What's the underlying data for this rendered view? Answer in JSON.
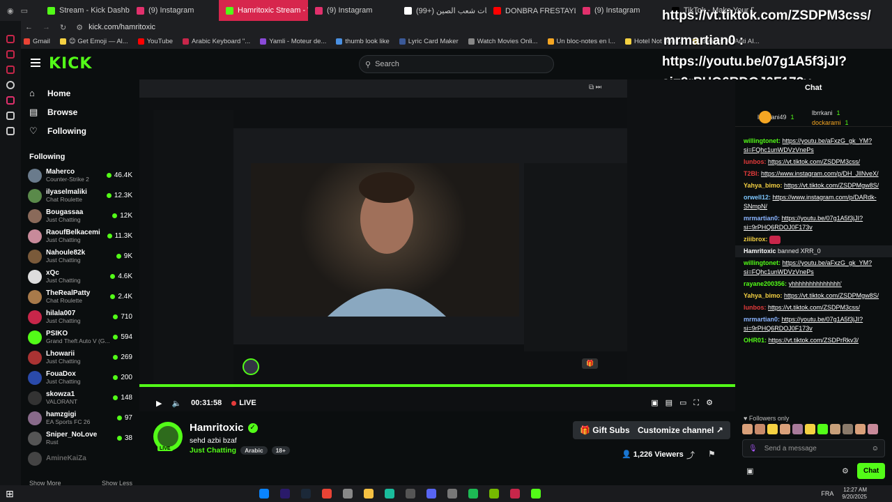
{
  "browser": {
    "tabs": [
      {
        "label": "Stream - Kick Dashboard",
        "color": "#53fc18",
        "active": false
      },
      {
        "label": "(9) Instagram",
        "color": "#e1306c",
        "active": false
      },
      {
        "label": "Hamritoxic Stream - Wat",
        "color": "#53fc18",
        "active": true
      },
      {
        "label": "(9) Instagram",
        "color": "#e1306c",
        "active": false
      },
      {
        "label": "(99+) ضحكات شعب الصين",
        "color": "#ffffff",
        "active": false
      },
      {
        "label": "DONBRA FRESTAYL 🔥 RI",
        "color": "#ff0000",
        "active": false
      },
      {
        "label": "(9) Instagram",
        "color": "#e1306c",
        "active": false
      },
      {
        "label": "TikTok - Make Your Day",
        "color": "#000000",
        "active": false
      }
    ],
    "url": "kick.com/hamritoxic",
    "bookmarks": [
      "Gmail",
      "😊 Get Emoji — Al...",
      "YouTube",
      "Arabic Keyboard \"...",
      "Yamli - Moteur de...",
      "thumb look like",
      "Lyric Card Maker",
      "Watch Movies Onli...",
      "Un bloc-notes en l...",
      "Hotel Not Hote...",
      "Bypass AI: Anti AI..."
    ]
  },
  "overlay": {
    "line1": "https://vt.tiktok.com/ZSDPM3css/",
    "line2": "mrmartian0 :",
    "line3": "https://youtu.be/07g1A5f3jJI?",
    "line4": "si=9rPHQ6RDOJ0F173v"
  },
  "kick": {
    "logo": "KICK",
    "search_placeholder": "Search",
    "nav": [
      {
        "label": "Home",
        "icon": "home-icon"
      },
      {
        "label": "Browse",
        "icon": "browse-icon"
      },
      {
        "label": "Following",
        "icon": "heart-icon"
      }
    ],
    "following_title": "Following",
    "channels": [
      {
        "name": "Maherco",
        "game": "Counter-Strike 2",
        "viewers": "46.4K",
        "color": "#6a7b8c"
      },
      {
        "name": "ilyaselmaliki",
        "game": "Chat Roulette",
        "viewers": "12.3K",
        "color": "#5a8a4a"
      },
      {
        "name": "Bougassaa",
        "game": "Just Chatting",
        "viewers": "12K",
        "color": "#8a6a5a"
      },
      {
        "name": "RaoufBelkacemi",
        "game": "Just Chatting",
        "viewers": "11.3K",
        "color": "#c88a9a"
      },
      {
        "name": "Nahoule82k",
        "game": "Just Chatting",
        "viewers": "9K",
        "color": "#7a5a3a"
      },
      {
        "name": "xQc",
        "game": "Just Chatting",
        "viewers": "4.6K",
        "color": "#dddddd"
      },
      {
        "name": "TheRealPatty",
        "game": "Chat Roulette",
        "viewers": "2.4K",
        "color": "#a87a4a"
      },
      {
        "name": "hilala007",
        "game": "Just Chatting",
        "viewers": "710",
        "color": "#c8264a"
      },
      {
        "name": "PSIKO",
        "game": "Grand Theft Auto V (G...",
        "viewers": "594",
        "color": "#53fc18"
      },
      {
        "name": "Lhowarii",
        "game": "Just Chatting",
        "viewers": "269",
        "color": "#aa3333"
      },
      {
        "name": "FouaDox",
        "game": "Just Chatting",
        "viewers": "200",
        "color": "#2a4aaa"
      },
      {
        "name": "skowza1",
        "game": "VALORANT",
        "viewers": "148",
        "color": "#333333"
      },
      {
        "name": "hamzgigi",
        "game": "EA Sports FC 26",
        "viewers": "97",
        "color": "#886a8a"
      },
      {
        "name": "Sniper_NoLove",
        "game": "Rust",
        "viewers": "38",
        "color": "#555555"
      },
      {
        "name": "AmineKaiZa",
        "game": "",
        "viewers": "",
        "color": "#444444"
      }
    ],
    "show_more": "Show More",
    "show_less": "Show Less",
    "player": {
      "time": "00:31:58",
      "live": "LIVE"
    },
    "streamer": {
      "name": "Hamritoxic",
      "title": "sehd azbi bzaf",
      "category": "Just Chatting",
      "tags": [
        "Arabic",
        "18+"
      ],
      "viewers": "1,226 Viewers",
      "gift_subs": "Gift Subs",
      "customize": "Customize channel"
    },
    "chat": {
      "header": "Chat",
      "gifters": [
        {
          "name": "lberkani49",
          "count": "1"
        },
        {
          "name": "lbrrkani",
          "count": "1"
        },
        {
          "name": "dockarami",
          "count": "1"
        }
      ],
      "messages": [
        {
          "user": "willingtonet:",
          "color": "#53fc18",
          "text": "https://youtu.be/aFxzG_gk_YM?si=FQhc1unWDVzVnePs"
        },
        {
          "user": "lunbos:",
          "color": "#e53b3b",
          "text": "https://vt.tiktok.com/ZSDPM3css/"
        },
        {
          "user": "T2BI:",
          "color": "#e53b3b",
          "text": "https://www.instagram.com/p/DH_JllNveX/"
        },
        {
          "user": "Yahya_bimo:",
          "color": "#f5d142",
          "text": "https://vt.tiktok.com/ZSDPMgw8S/"
        },
        {
          "user": "orwell12:",
          "color": "#7ec8ff",
          "text": "https://www.instagram.com/p/DARdk-SNmpN/"
        },
        {
          "user": "mrmartian0:",
          "color": "#8ab4ff",
          "text": "https://youtu.be/07g1A5f3jJI?si=9rPHQ6RDOJ0F173v"
        },
        {
          "user": "ziiibrox:",
          "color": "#f5d142",
          "text": ""
        },
        {
          "user": "Hamritoxic",
          "color": "#ffffff",
          "text": "banned XRR_0",
          "system": true
        },
        {
          "user": "willingtonet:",
          "color": "#53fc18",
          "text": "https://youtu.be/aFxzG_gk_YM?si=FQhc1unWDVzVnePs"
        },
        {
          "user": "rayane200356:",
          "color": "#53fc18",
          "text": "yhhhhhhhhhhhhhh'"
        },
        {
          "user": "Yahya_bimo:",
          "color": "#f5d142",
          "text": "https://vt.tiktok.com/ZSDPMgw8S/"
        },
        {
          "user": "lunbos:",
          "color": "#e53b3b",
          "text": "https://vt.tiktok.com/ZSDPM3css/"
        },
        {
          "user": "mrmartian0:",
          "color": "#8ab4ff",
          "text": "https://youtu.be/07g1A5f3jJI?si=9rPHQ6RDOJ0F173v"
        },
        {
          "user": "OHR01:",
          "color": "#53fc18",
          "text": "https://vt.tiktok.com/ZSDPrRkv3/"
        }
      ],
      "followers_only": "Followers only",
      "send_placeholder": "Send a message",
      "chat_button": "Chat"
    }
  },
  "taskbar": {
    "lang": "FRA",
    "time": "12:27 AM",
    "date": "9/20/2025"
  }
}
